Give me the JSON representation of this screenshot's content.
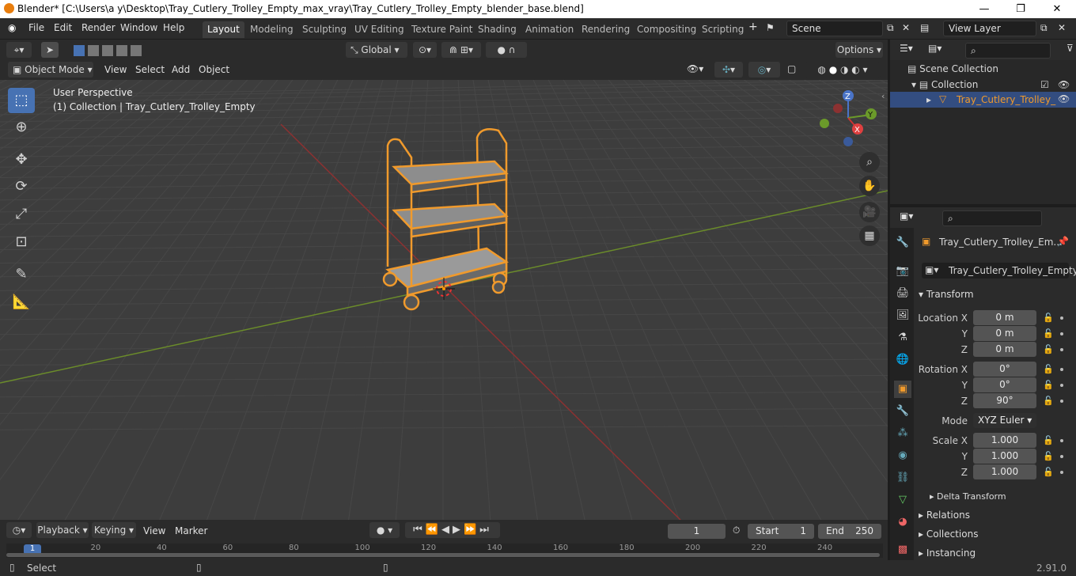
{
  "window": {
    "title": "Blender* [C:\\Users\\a y\\Desktop\\Tray_Cutlery_Trolley_Empty_max_vray\\Tray_Cutlery_Trolley_Empty_blender_base.blend]"
  },
  "menu": [
    "File",
    "Edit",
    "Render",
    "Window",
    "Help"
  ],
  "workspaces": [
    "Layout",
    "Modeling",
    "Sculpting",
    "UV Editing",
    "Texture Paint",
    "Shading",
    "Animation",
    "Rendering",
    "Compositing",
    "Scripting"
  ],
  "scene": {
    "name": "Scene",
    "view_layer": "View Layer"
  },
  "header": {
    "orientation": "Global",
    "options": "Options"
  },
  "viewport_header": {
    "mode": "Object Mode",
    "menus": [
      "View",
      "Select",
      "Add",
      "Object"
    ]
  },
  "viewport": {
    "perspective": "User Perspective",
    "collection_info": "(1) Collection | Tray_Cutlery_Trolley_Empty"
  },
  "gizmo": {
    "x": "X",
    "y": "Y",
    "z": "Z"
  },
  "outliner": {
    "scene_collection": "Scene Collection",
    "collection": "Collection",
    "object": "Tray_Cutlery_Trolley_"
  },
  "properties": {
    "object_name_header": "Tray_Cutlery_Trolley_Em...",
    "object_name": "Tray_Cutlery_Trolley_Empty",
    "transform_label": "Transform",
    "location": {
      "label": "Location X",
      "y_label": "Y",
      "z_label": "Z",
      "x": "0 m",
      "y": "0 m",
      "z": "0 m"
    },
    "rotation": {
      "label": "Rotation X",
      "y_label": "Y",
      "z_label": "Z",
      "x": "0°",
      "y": "0°",
      "z": "90°"
    },
    "mode": {
      "label": "Mode",
      "value": "XYZ Euler"
    },
    "scale": {
      "label": "Scale X",
      "y_label": "Y",
      "z_label": "Z",
      "x": "1.000",
      "y": "1.000",
      "z": "1.000"
    },
    "sections": [
      "Delta Transform",
      "Relations",
      "Collections",
      "Instancing"
    ]
  },
  "timeline": {
    "menus": [
      "Playback",
      "Keying",
      "View",
      "Marker"
    ],
    "current_frame": "1",
    "start_label": "Start",
    "start": "1",
    "end_label": "End",
    "end": "250",
    "ruler": [
      "1",
      "20",
      "40",
      "60",
      "80",
      "100",
      "120",
      "140",
      "160",
      "180",
      "200",
      "220",
      "240"
    ]
  },
  "status": {
    "left": "Select",
    "version": "2.91.0"
  }
}
